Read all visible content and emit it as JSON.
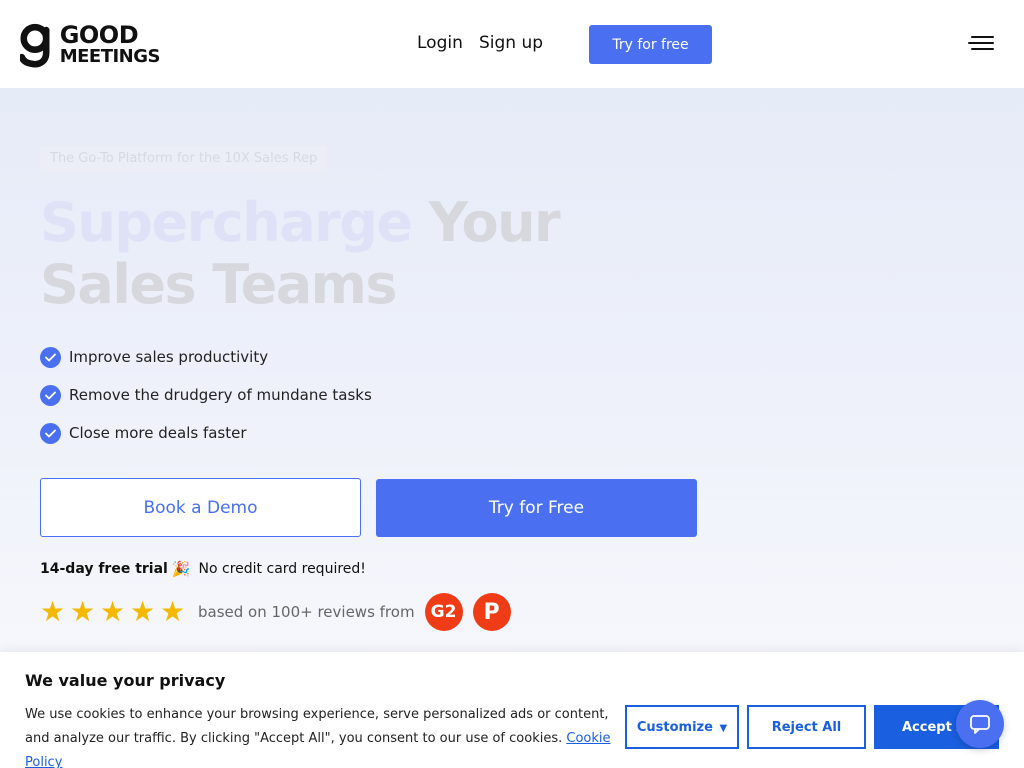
{
  "brand": {
    "line1": "GOOD",
    "line2": "MEETINGS",
    "accent_color": "#4a6ff0"
  },
  "nav": {
    "login": "Login",
    "signup": "Sign up",
    "try_free": "Try for free",
    "menu_icon": "hamburger-menu-icon"
  },
  "hero": {
    "eyebrow": "The Go-To Platform for the 10X Sales Rep",
    "headline_accent": "Supercharge",
    "headline_rest1": " Your",
    "headline_line2": "Sales Teams",
    "features": [
      "Improve sales productivity",
      "Remove the drudgery of mundane tasks",
      "Close more deals faster"
    ],
    "book_demo": "Book a Demo",
    "try_free": "Try for Free",
    "trial_bold": "14-day free trial",
    "trial_rest": "No credit card required!",
    "rating_stars": 5,
    "reviews_text": "based on 100+ reviews from",
    "badges": [
      "G2",
      "P"
    ]
  },
  "cookie": {
    "title": "We value your privacy",
    "text": "We use cookies to enhance your browsing experience, serve personalized ads or content, and analyze our traffic. By clicking \"Accept All\", you consent to our use of cookies.",
    "policy_link": "Cookie Policy",
    "customize": "Customize",
    "reject": "Reject All",
    "accept": "Accept All",
    "button_color": "#1a5fe0"
  }
}
